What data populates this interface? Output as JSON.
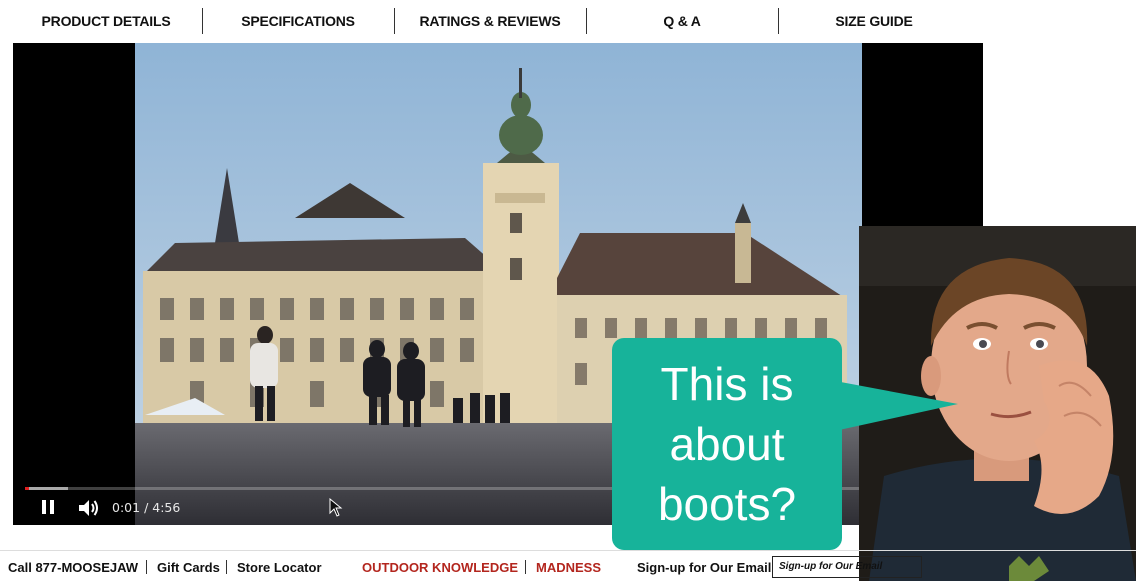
{
  "tabs": [
    {
      "label": "PRODUCT DETAILS"
    },
    {
      "label": "SPECIFICATIONS"
    },
    {
      "label": "RATINGS & REVIEWS"
    },
    {
      "label": "Q & A"
    },
    {
      "label": "SIZE GUIDE"
    }
  ],
  "video": {
    "current_time": "0:01",
    "duration": "4:56",
    "time_separator": "/",
    "played_fraction": 0.004,
    "buffered_fraction": 0.045,
    "state": "playing"
  },
  "overlay": {
    "bubble_text": "This is\nabout\nboots?",
    "bubble_color": "#17b39a"
  },
  "footer": {
    "phone": "Call 877-MOOSEJAW",
    "gift_cards": "Gift Cards",
    "store_locator": "Store Locator",
    "outdoor_knowledge": "OUTDOOR KNOWLEDGE",
    "madness": "MADNESS",
    "signup_label": "Sign-up for Our Email",
    "email_placeholder": "Sign-up for Our Email",
    "accent_red": "#b3261e"
  },
  "icons": {
    "pause": "pause-icon",
    "volume": "volume-icon",
    "cursor": "mouse-cursor-icon"
  }
}
